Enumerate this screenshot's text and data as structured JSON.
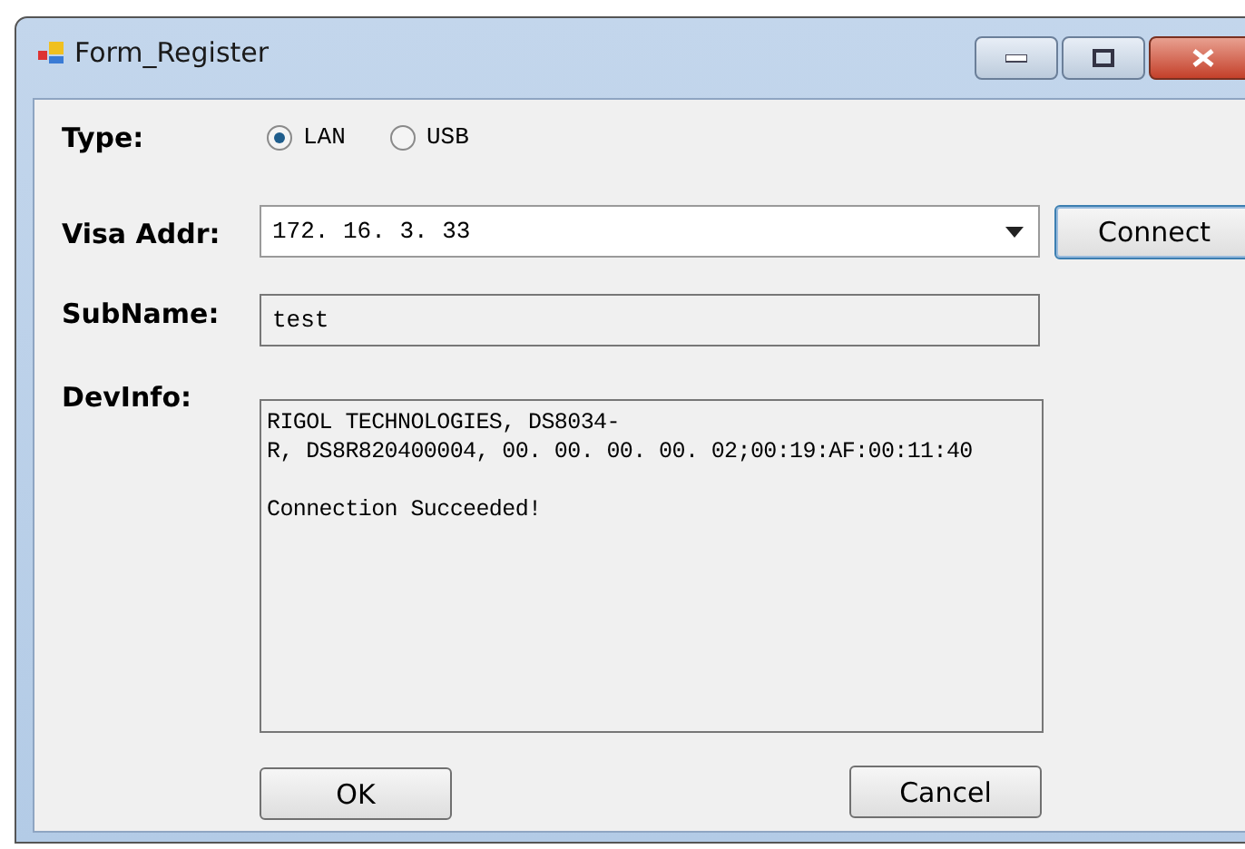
{
  "window": {
    "title": "Form_Register"
  },
  "type": {
    "label": "Type:",
    "options": [
      {
        "label": "LAN",
        "selected": true
      },
      {
        "label": "USB",
        "selected": false
      }
    ]
  },
  "visa_addr": {
    "label": "Visa Addr:",
    "value": "172. 16. 3. 33",
    "button": "Connect"
  },
  "subname": {
    "label": "SubName:",
    "value": "test"
  },
  "devinfo": {
    "label": "DevInfo:",
    "lines": [
      "RIGOL TECHNOLOGIES, DS8034-",
      "R, DS8R820400004, 00. 00. 00. 00. 02;00:19:AF:00:11:40"
    ],
    "message": "Connection Succeeded!"
  },
  "buttons": [
    "OK",
    "Cancel"
  ]
}
